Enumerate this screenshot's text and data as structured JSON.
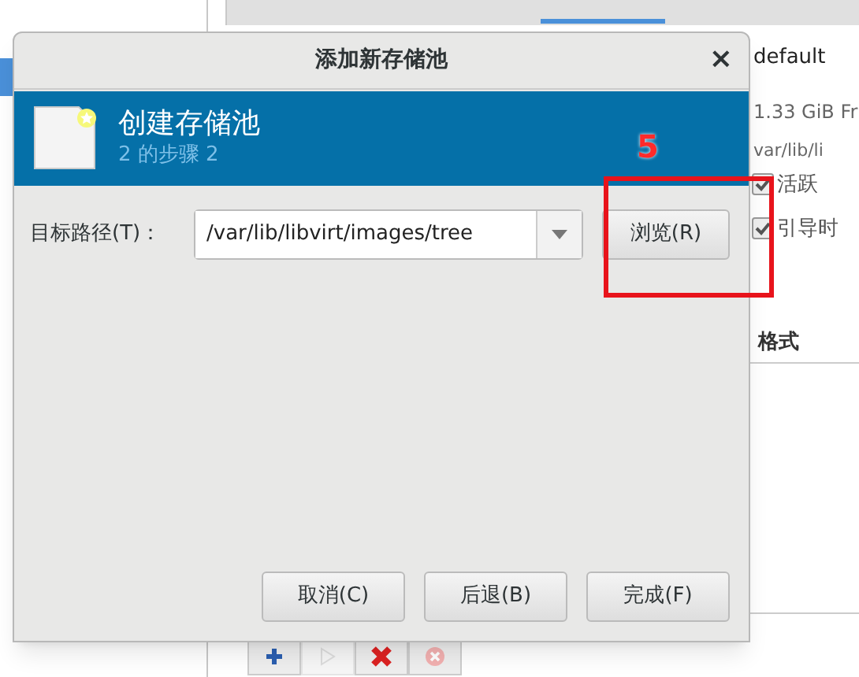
{
  "background_window": {
    "pool_name": "default",
    "size_info": "1.33 GiB Fr",
    "location": "var/lib/li",
    "options": [
      {
        "label": "活跃",
        "checked": true
      },
      {
        "label": "引导时",
        "checked": true
      }
    ],
    "table_columns": [
      "格式"
    ],
    "toolbar": [
      {
        "kind": "add",
        "disabled": false
      },
      {
        "kind": "start",
        "disabled": true
      },
      {
        "kind": "delete",
        "disabled": false
      },
      {
        "kind": "stop",
        "disabled": false
      }
    ]
  },
  "dialog": {
    "title": "添加新存储池",
    "close": "×",
    "header": {
      "title": "创建存储池",
      "subtitle": "2 的步骤 2"
    },
    "target_path": {
      "label": "目标路径(T)：",
      "value": "/var/lib/libvirt/images/tree",
      "browse": "浏览(R)"
    },
    "buttons": [
      "取消(C)",
      "后退(B)",
      "完成(F)"
    ]
  },
  "annotation": {
    "label": "5"
  }
}
